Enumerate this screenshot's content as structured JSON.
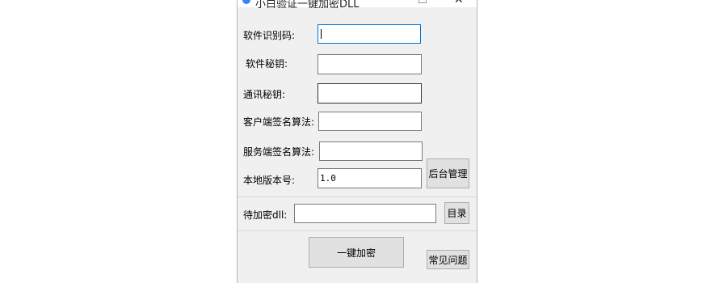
{
  "window": {
    "title": "小白验证一键加密DLL",
    "minimize_glyph": "—",
    "close_glyph": "✕"
  },
  "form": {
    "software_id_label": "软件识别码:",
    "software_id_value": "",
    "software_secret_label": "软件秘钥:",
    "software_secret_value": "",
    "comm_secret_label": "通讯秘钥:",
    "comm_secret_value": "",
    "client_sign_label": "客户端签名算法:",
    "client_sign_value": "",
    "server_sign_label": "服务端签名算法:",
    "server_sign_value": "",
    "local_version_label": "本地版本号:",
    "local_version_value": "1.0"
  },
  "buttons": {
    "admin": "后台管理",
    "browse": "目录",
    "encrypt": "一键加密",
    "faq": "常见问题"
  },
  "dll": {
    "label": "待加密dll:",
    "value": ""
  },
  "colors": {
    "window_bg": "#f0f0f0",
    "focus_border": "#0078d7",
    "title_icon": "#3b82f6"
  }
}
